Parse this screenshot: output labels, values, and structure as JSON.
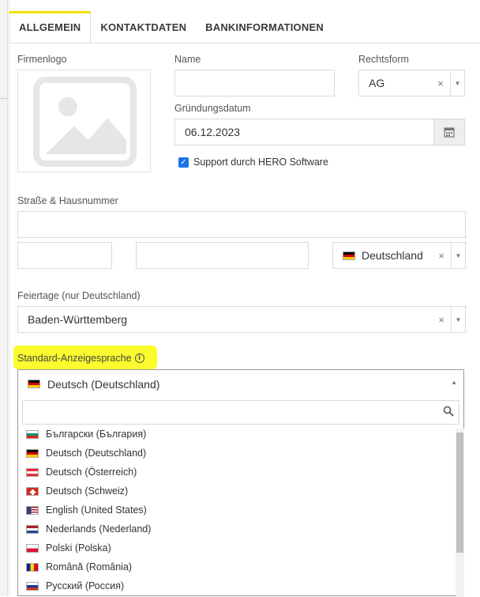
{
  "tabs": [
    {
      "label": "ALLGEMEIN",
      "active": true
    },
    {
      "label": "KONTAKTDATEN",
      "active": false
    },
    {
      "label": "BANKINFORMATIONEN",
      "active": false
    }
  ],
  "form": {
    "firmenlogo_label": "Firmenlogo",
    "name_label": "Name",
    "name_value": "",
    "rechtsform_label": "Rechtsform",
    "rechtsform_value": "AG",
    "gruendungsdatum_label": "Gründungsdatum",
    "gruendungsdatum_value": "06.12.2023",
    "support_label": "Support durch HERO Software",
    "support_checked": true,
    "strasse_label": "Straße & Hausnummer",
    "strasse_value": "",
    "plz_value": "",
    "ort_value": "",
    "land_value": "Deutschland",
    "feiertage_label": "Feiertage (nur Deutschland)",
    "feiertage_value": "Baden-Württemberg",
    "sprache_label": "Standard-Anzeigesprache",
    "sprache_value": "Deutsch (Deutschland)"
  },
  "language_options": [
    {
      "label": "Български (България)",
      "flag": "bg"
    },
    {
      "label": "Deutsch (Deutschland)",
      "flag": "de"
    },
    {
      "label": "Deutsch (Österreich)",
      "flag": "at"
    },
    {
      "label": "Deutsch (Schweiz)",
      "flag": "ch"
    },
    {
      "label": "English (United States)",
      "flag": "us"
    },
    {
      "label": "Nederlands (Nederland)",
      "flag": "nl"
    },
    {
      "label": "Polski (Polska)",
      "flag": "pl"
    },
    {
      "label": "Română (România)",
      "flag": "ro"
    },
    {
      "label": "Русский (Россия)",
      "flag": "ru"
    }
  ],
  "icons": {
    "clear": "×",
    "dropdown": "▼",
    "dropdown_open": "▲",
    "check": "✓",
    "info": "i"
  },
  "colors": {
    "tab_accent": "#f2e000",
    "highlight": "#fbfb2d",
    "checkbox": "#1a73e8"
  }
}
